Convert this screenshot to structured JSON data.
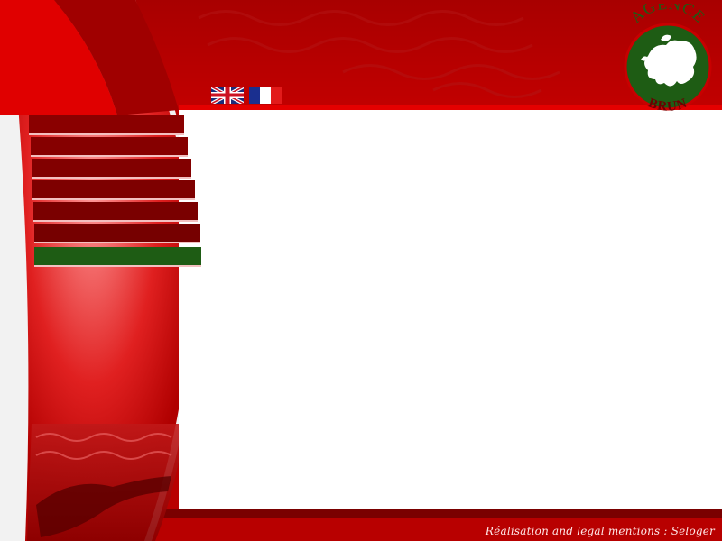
{
  "header": {
    "logo": {
      "top_text": "AGENCE",
      "bottom_text": "BRUN",
      "icon": "europe-map-icon"
    }
  },
  "languages": [
    {
      "code": "en",
      "icon": "uk-flag-icon"
    },
    {
      "code": "fr",
      "icon": "france-flag-icon"
    }
  ],
  "navigation": {
    "items": [
      {
        "label": ""
      },
      {
        "label": ""
      },
      {
        "label": ""
      },
      {
        "label": ""
      },
      {
        "label": ""
      },
      {
        "label": ""
      },
      {
        "label": "",
        "active": true
      }
    ]
  },
  "footer": {
    "credits": "Réalisation and legal mentions : Seloger"
  },
  "colors": {
    "primary_red": "#c80000",
    "dark_red": "#7a0000",
    "accent_green": "#1e5c14",
    "white": "#ffffff"
  }
}
